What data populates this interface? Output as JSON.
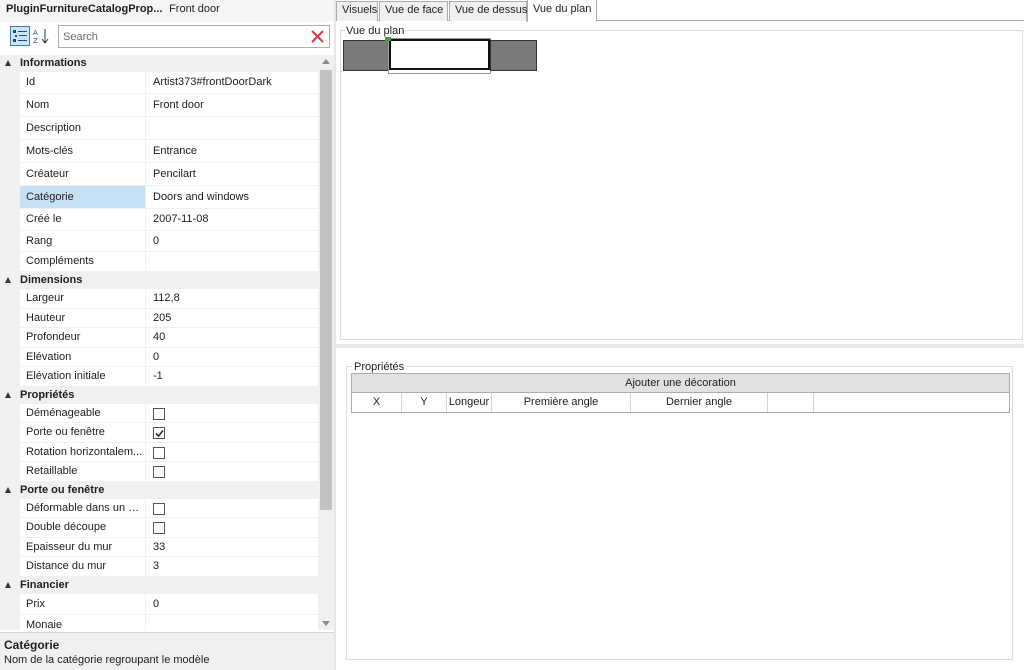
{
  "panel": {
    "title": "PluginFurnitureCatalogProp...",
    "subtitle": "Front door",
    "search_placeholder": "Search"
  },
  "categories": {
    "informations": "Informations",
    "dimensions": "Dimensions",
    "proprietes": "Propriétés",
    "porte": "Porte ou fenêtre",
    "financier": "Financier"
  },
  "info_rows": [
    {
      "name": "Id",
      "value": "Artist373#frontDoorDark"
    },
    {
      "name": "Nom",
      "value": "Front door"
    },
    {
      "name": "Description",
      "value": ""
    },
    {
      "name": "Mots-clés",
      "value": "Entrance"
    },
    {
      "name": "Créateur",
      "value": "Pencilart"
    },
    {
      "name": "Catégorie",
      "value": "Doors and windows"
    },
    {
      "name": "Créé le",
      "value": "2007-11-08"
    },
    {
      "name": "Rang",
      "value": "0"
    },
    {
      "name": "Compléments",
      "value": ""
    }
  ],
  "dim_rows": [
    {
      "name": "Largeur",
      "value": "112,8"
    },
    {
      "name": "Hauteur",
      "value": "205"
    },
    {
      "name": "Profondeur",
      "value": "40"
    },
    {
      "name": "Elévation",
      "value": "0"
    },
    {
      "name": "Elévation initiale",
      "value": "-1"
    }
  ],
  "prop_rows": [
    {
      "name": "Déménageable",
      "checked": false
    },
    {
      "name": "Porte ou fenêtre",
      "checked": true
    },
    {
      "name": "Rotation horizontalem...",
      "checked": false
    },
    {
      "name": "Retaillable",
      "checked": false
    }
  ],
  "porte_rows": [
    {
      "name": "Déformable dans un m...",
      "type": "check",
      "checked": false
    },
    {
      "name": "Double découpe",
      "type": "check",
      "checked": false
    },
    {
      "name": "Epaisseur du mur",
      "type": "text",
      "value": "33"
    },
    {
      "name": "Distance du mur",
      "type": "text",
      "value": "3"
    }
  ],
  "fin_rows": [
    {
      "name": "Prix",
      "value": "0"
    },
    {
      "name": "Monaie",
      "value": ""
    }
  ],
  "description": {
    "title": "Catégorie",
    "text": "Nom de la catégorie regroupant le modèle"
  },
  "tabs": [
    "Visuels",
    "Vue de face",
    "Vue de dessus",
    "Vue du plan"
  ],
  "active_tab": "Vue du plan",
  "plan": {
    "legend": "Vue du plan"
  },
  "props": {
    "legend": "Propriétés",
    "add_button": "Ajouter une décoration",
    "columns": [
      "X",
      "Y",
      "Longeur",
      "Première angle",
      "Dernier angle",
      ""
    ]
  },
  "colors": {
    "selection": "#c6e0f5",
    "category_bg": "#f0f0f0",
    "door_fill": "#7a7a7a"
  },
  "icons": [
    "categorized-icon",
    "sort-az-icon",
    "clear-search-icon",
    "checkmark-icon"
  ]
}
